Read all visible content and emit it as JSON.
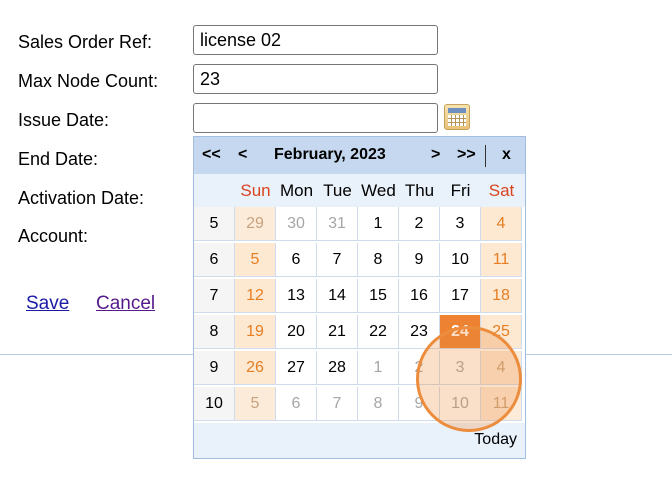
{
  "form": {
    "sales_order_label": "Sales Order Ref:",
    "sales_order_value": "license 02",
    "max_node_label": "Max Node Count:",
    "max_node_value": "23",
    "issue_date_label": "Issue Date:",
    "issue_date_value": "",
    "end_date_label": "End Date:",
    "activation_date_label": "Activation Date:",
    "account_label": "Account:",
    "save_label": "Save",
    "cancel_label": "Cancel",
    "calendar_icon": "calendar-icon"
  },
  "calendar": {
    "prev_year": "<<",
    "prev_month": "<",
    "title": "February, 2023",
    "next_month": ">",
    "next_year": ">>",
    "close": "x",
    "day_headers": [
      "Sun",
      "Mon",
      "Tue",
      "Wed",
      "Thu",
      "Fri",
      "Sat"
    ],
    "weeks": [
      {
        "num": "5",
        "days": [
          "29",
          "30",
          "31",
          "1",
          "2",
          "3",
          "4"
        ]
      },
      {
        "num": "6",
        "days": [
          "5",
          "6",
          "7",
          "8",
          "9",
          "10",
          "11"
        ]
      },
      {
        "num": "7",
        "days": [
          "12",
          "13",
          "14",
          "15",
          "16",
          "17",
          "18"
        ]
      },
      {
        "num": "8",
        "days": [
          "19",
          "20",
          "21",
          "22",
          "23",
          "24",
          "25"
        ]
      },
      {
        "num": "9",
        "days": [
          "26",
          "27",
          "28",
          "1",
          "2",
          "3",
          "4"
        ]
      },
      {
        "num": "10",
        "days": [
          "5",
          "6",
          "7",
          "8",
          "9",
          "10",
          "11"
        ]
      }
    ],
    "selected_day": "24",
    "today_label": "Today",
    "colors": {
      "header_bg": "#c5d8ef",
      "weekend": "#d9441f",
      "selected": "#ec8232",
      "highlight": "#ec8d3e"
    }
  }
}
